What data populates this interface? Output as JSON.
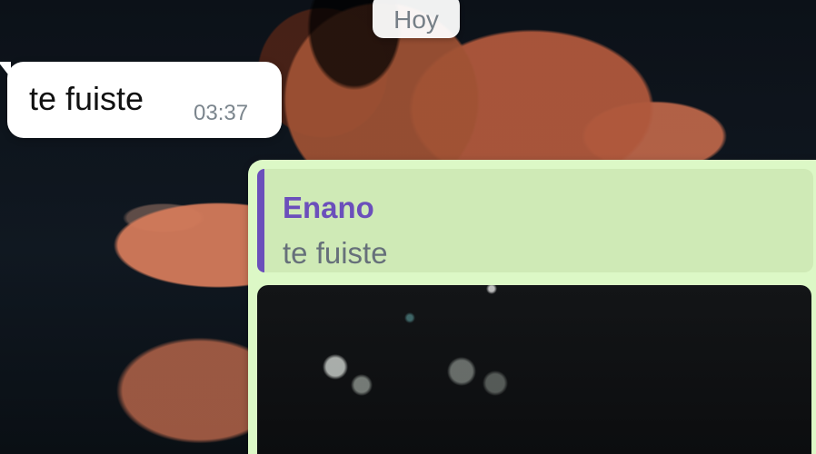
{
  "chat": {
    "date_label": "Hoy",
    "incoming_message": {
      "text": "te fuiste",
      "time": "03:37"
    },
    "outgoing_message": {
      "quoted_sender": "Enano",
      "quoted_text": "te fuiste"
    }
  },
  "colors": {
    "incoming_bubble": "#ffffff",
    "outgoing_bubble": "#dcf8c6",
    "quoted_sender": "#6b4fbb",
    "timestamp": "#7b858d"
  }
}
